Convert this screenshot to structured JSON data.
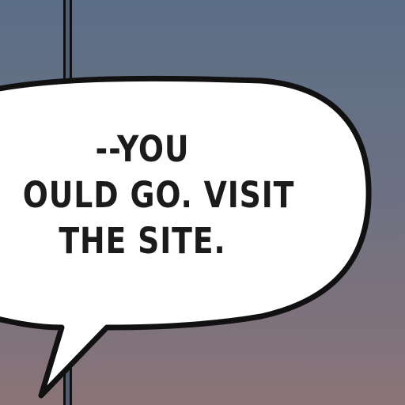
{
  "colors": {
    "sky_top": "#5a6e86",
    "sky_bottom": "#8a7478",
    "bubble_fill": "#ffffff",
    "ink": "#111111"
  },
  "speech_bubble": {
    "lines": [
      "--YOU",
      "OULD GO. VISIT",
      "THE SITE."
    ]
  }
}
